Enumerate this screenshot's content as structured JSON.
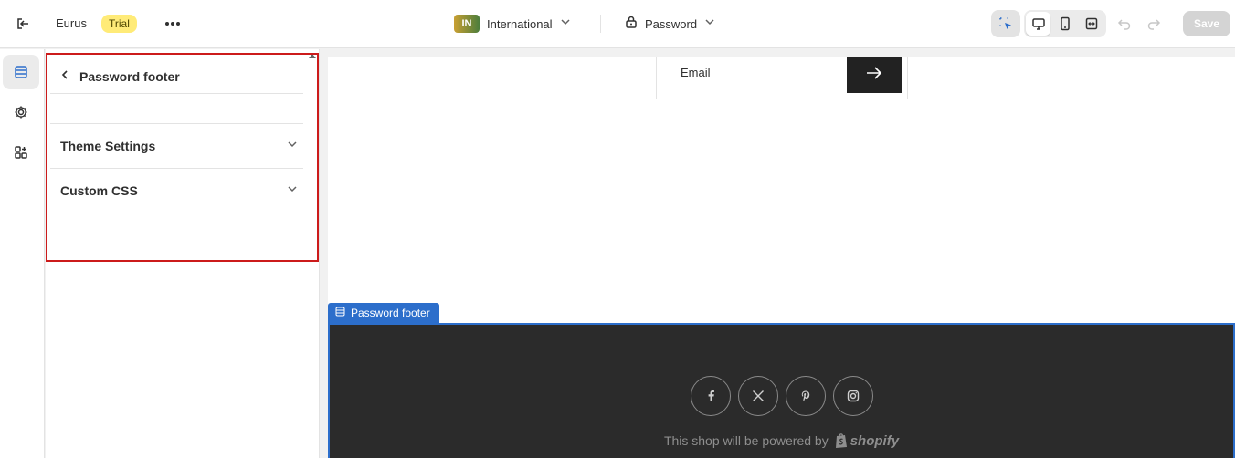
{
  "topbar": {
    "store_name": "Eurus",
    "plan_badge": "Trial",
    "market_code": "IN",
    "market_name": "International",
    "page_name": "Password",
    "save_label": "Save"
  },
  "panel": {
    "title": "Password footer",
    "sections": [
      {
        "label": "Theme Settings"
      },
      {
        "label": "Custom CSS"
      }
    ]
  },
  "preview": {
    "email_label": "Email",
    "section_tag": "Password footer",
    "powered_text": "This shop will be powered by",
    "shopify_word": "shopify",
    "social_icons": [
      "facebook-icon",
      "x-icon",
      "pinterest-icon",
      "instagram-icon"
    ]
  },
  "colors": {
    "accent": "#2c6ecb",
    "highlight": "#cc1b1b",
    "badge": "#ffeb78",
    "footer_bg": "#2b2b2b"
  }
}
